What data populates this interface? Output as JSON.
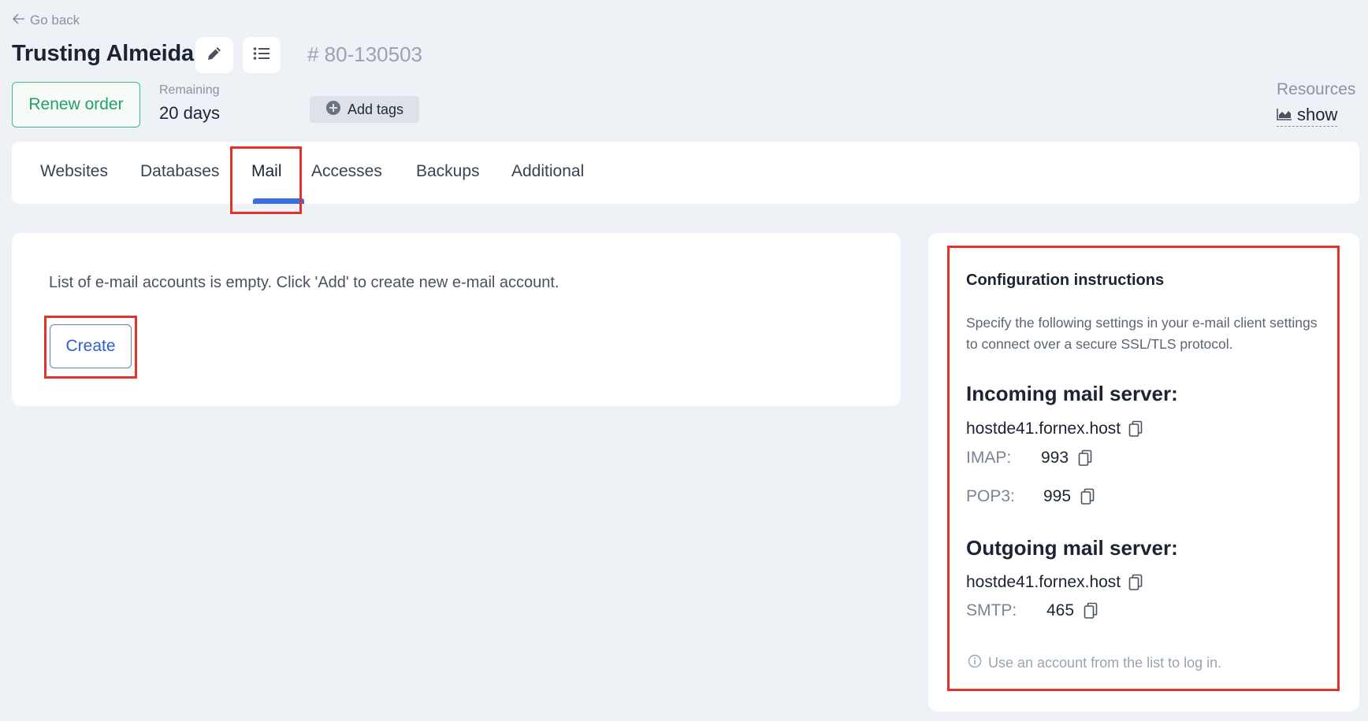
{
  "header": {
    "go_back": "Go back",
    "title": "Trusting Almeida",
    "order_id": "# 80-130503",
    "renew_label": "Renew order",
    "remaining_label": "Remaining",
    "remaining_value": "20 days",
    "add_tags": "Add tags",
    "resources_label": "Resources",
    "resources_show": "show"
  },
  "tabs": [
    {
      "label": "Websites"
    },
    {
      "label": "Databases"
    },
    {
      "label": "Mail"
    },
    {
      "label": "Accesses"
    },
    {
      "label": "Backups"
    },
    {
      "label": "Additional"
    }
  ],
  "mail": {
    "empty_message": "List of e-mail accounts is empty. Click 'Add' to create new e-mail account.",
    "create_label": "Create"
  },
  "config": {
    "title": "Configuration instructions",
    "description": "Specify the following settings in your e-mail client settings to connect over a secure SSL/TLS protocol.",
    "incoming_title": "Incoming mail server:",
    "incoming_host": "hostde41.fornex.host",
    "imap_label": "IMAP:",
    "imap_port": "993",
    "pop3_label": "POP3:",
    "pop3_port": "995",
    "outgoing_title": "Outgoing mail server:",
    "outgoing_host": "hostde41.fornex.host",
    "smtp_label": "SMTP:",
    "smtp_port": "465",
    "note": "Use an account from the list to log in."
  },
  "colors": {
    "accent": "#3b6ee0",
    "renew_green": "#22a06b",
    "highlight_red": "#e0342b"
  }
}
